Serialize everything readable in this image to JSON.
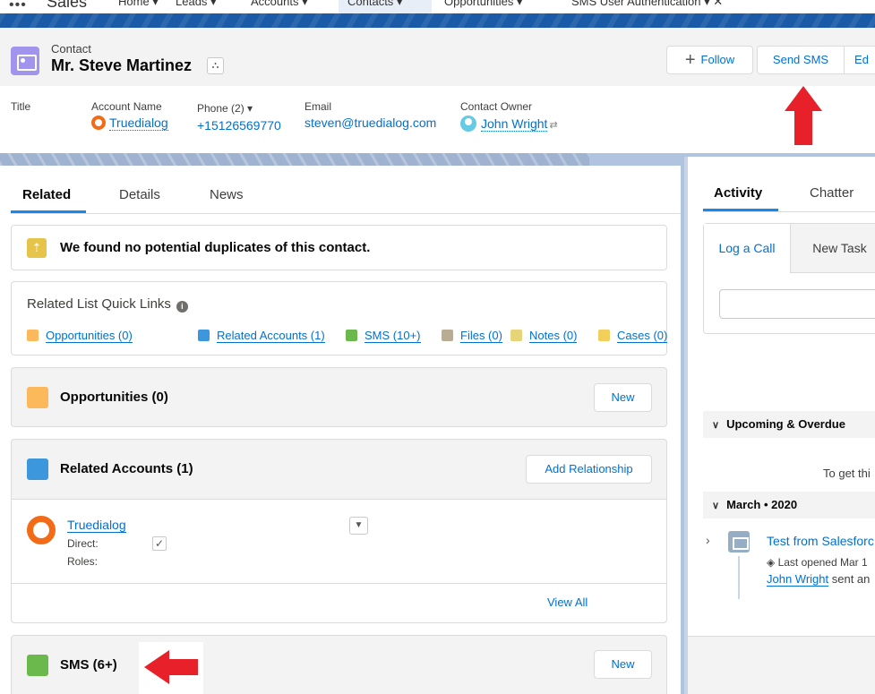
{
  "nav": {
    "dots": "•••",
    "app_name": "Sales",
    "tabs": [
      {
        "label": "Home ▾",
        "active": false
      },
      {
        "label": "Leads ▾",
        "active": false
      },
      {
        "label": "Accounts ▾",
        "active": false
      },
      {
        "label": "Contacts ▾",
        "active": true
      },
      {
        "label": "Opportunities ▾",
        "active": false
      },
      {
        "label": "SMS User Authentication ▾  ✕",
        "active": false
      }
    ]
  },
  "header": {
    "object_type": "Contact",
    "name": "Mr. Steve Martinez",
    "hierarchy_glyph": "⛬",
    "follow_label": "Follow",
    "follow_glyph": "+",
    "send_sms_label": "Send SMS",
    "edit_label": "Ed"
  },
  "highlights": {
    "title_label": "Title",
    "account_label": "Account Name",
    "account_value": "Truedialog",
    "phone_label": "Phone (2) ▾",
    "phone_value": "+15126569770",
    "email_label": "Email",
    "email_value": "steven@truedialog.com",
    "owner_label": "Contact Owner",
    "owner_value": "John Wright",
    "owner_change_glyph": "⇄"
  },
  "left_tabs": {
    "related": "Related",
    "details": "Details",
    "news": "News"
  },
  "duplicates": {
    "icon": "⇡",
    "text": "We found no potential duplicates of this contact."
  },
  "quick_links": {
    "title": "Related List Quick Links",
    "info_glyph": "i",
    "links": [
      {
        "label": "Opportunities (0)",
        "color": "#fcb95b"
      },
      {
        "label": "Related Accounts (1)",
        "color": "#3c97dd"
      },
      {
        "label": "SMS (10+)",
        "color": "#6bb84c"
      },
      {
        "label": "Files (0)",
        "color": "#baac93"
      },
      {
        "label": "Notes (0)",
        "color": "#e6d478"
      },
      {
        "label": "Cases (0)",
        "color": "#f2cf5b"
      }
    ]
  },
  "opportunities": {
    "title": "Opportunities (0)",
    "button": "New",
    "icon_color": "#fcb95b"
  },
  "related_accounts": {
    "title": "Related Accounts (1)",
    "button": "Add Relationship",
    "icon_color": "#3c97dd",
    "record": {
      "name": "Truedialog",
      "direct_label": "Direct:",
      "direct_check": "✓",
      "roles_label": "Roles:",
      "dropdown": "▼"
    },
    "view_all": "View All"
  },
  "sms": {
    "title": "SMS (6+)",
    "button": "New",
    "icon_color": "#6bb84c"
  },
  "activity": {
    "tabs": {
      "activity": "Activity",
      "chatter": "Chatter"
    },
    "subtabs": {
      "log_call": "Log a Call",
      "new_task": "New Task"
    },
    "upcoming": "Upcoming & Overdue",
    "upcoming_chevron": "∨",
    "get_text": "To get thi",
    "month": "March • 2020",
    "item_chevron": "›",
    "item_title": "Test from Salesforc",
    "item_sub": "Last opened Mar 1",
    "item_sub_glyph": "◈",
    "item_user": "John Wright",
    "item_action": " sent an"
  },
  "annotation_color": "#e8202a"
}
